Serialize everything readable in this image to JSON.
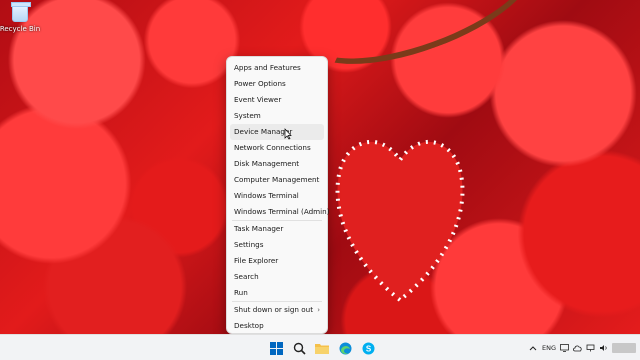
{
  "desktop": {
    "recycle_bin_label": "Recycle Bin"
  },
  "context_menu": {
    "items": [
      {
        "label": "Apps and Features"
      },
      {
        "label": "Power Options"
      },
      {
        "label": "Event Viewer"
      },
      {
        "label": "System"
      },
      {
        "label": "Device Manager"
      },
      {
        "label": "Network Connections"
      },
      {
        "label": "Disk Management"
      },
      {
        "label": "Computer Management"
      },
      {
        "label": "Windows Terminal"
      },
      {
        "label": "Windows Terminal (Admin)"
      },
      {
        "label": "Task Manager"
      },
      {
        "label": "Settings"
      },
      {
        "label": "File Explorer"
      },
      {
        "label": "Search"
      },
      {
        "label": "Run"
      },
      {
        "label": "Shut down or sign out"
      },
      {
        "label": "Desktop"
      }
    ],
    "hovered": "Device Manager"
  },
  "taskbar": {
    "pinned": [
      "windows-start-icon",
      "search-icon",
      "file-explorer-icon",
      "edge-icon",
      "skype-icon"
    ],
    "tray": {
      "language": "ENG"
    }
  },
  "colors": {
    "accent_start": "#0067c0",
    "edge": "#0c8ed9",
    "skype": "#00aff0",
    "folder": "#f5c04a"
  }
}
